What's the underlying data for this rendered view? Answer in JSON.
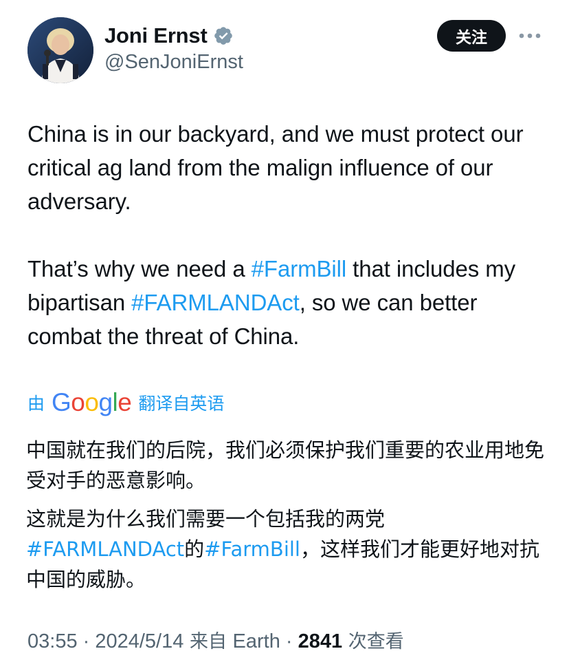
{
  "author": {
    "display_name": "Joni Ernst",
    "handle": "@SenJoniErnst",
    "verified_icon": "verified-badge-icon"
  },
  "header": {
    "follow_label": "关注",
    "more_icon": "more-dots-icon"
  },
  "tweet": {
    "paragraph1": "China is in our backyard, and we must protect our critical ag land from the malign influence of our adversary.",
    "p2_before": "That’s why we need a ",
    "p2_tag1": "#FarmBill",
    "p2_middle": " that includes my bipartisan ",
    "p2_tag2": "#FARMLANDAct",
    "p2_after": ", so we can better combat the threat of China."
  },
  "translation_bar": {
    "prefix": "由",
    "google_letters": [
      "G",
      "o",
      "o",
      "g",
      "l",
      "e"
    ],
    "link_label": "翻译自英语"
  },
  "translated": {
    "paragraph1": "中国就在我们的后院，我们必须保护我们重要的农业用地免受对手的恶意影响。",
    "p2_before": "这就是为什么我们需要一个包括我的两党",
    "p2_tag1": "#FARMLANDAct",
    "p2_middle": "的",
    "p2_tag2": "#FarmBill",
    "p2_after": "，这样我们才能更好地对抗中国的威胁。"
  },
  "footer": {
    "time": "03:55",
    "sep1": " · ",
    "date": "2024/5/14",
    "source_prefix": " 来自 ",
    "source": "Earth",
    "sep2": " · ",
    "views_count": "2841",
    "views_label": " 次查看"
  },
  "colors": {
    "text": "#0f1419",
    "secondary": "#536471",
    "link": "#1d9bf0",
    "verified": "#829aab",
    "button_bg": "#0f1419"
  }
}
